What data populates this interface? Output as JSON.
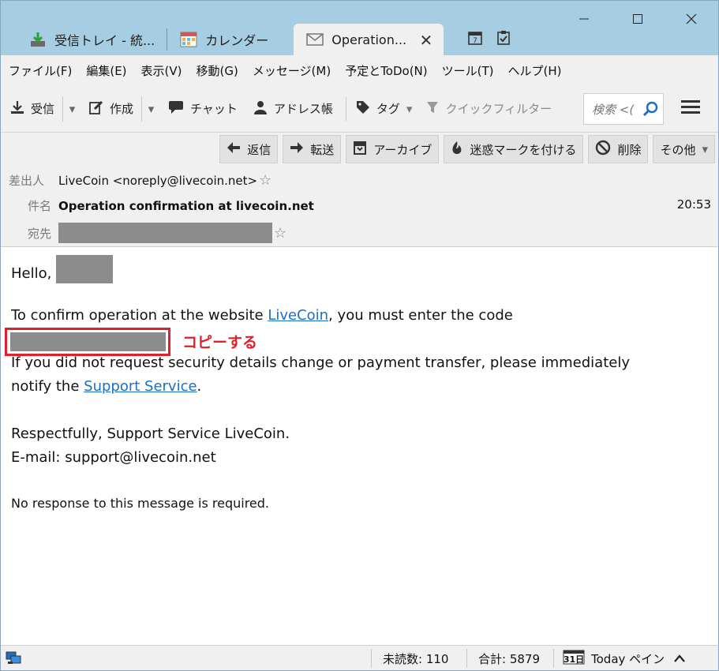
{
  "window": {
    "tabs": [
      {
        "label": "受信トレイ - 統..."
      },
      {
        "label": "カレンダー"
      },
      {
        "label": "Operation..."
      }
    ]
  },
  "menubar": {
    "items": [
      "ファイル(F)",
      "編集(E)",
      "表示(V)",
      "移動(G)",
      "メッセージ(M)",
      "予定とToDo(N)",
      "ツール(T)",
      "ヘルプ(H)"
    ]
  },
  "toolbar": {
    "receive": "受信",
    "compose": "作成",
    "chat": "チャット",
    "address_book": "アドレス帳",
    "tag": "タグ",
    "quick_filter": "クイックフィルター",
    "search_placeholder": "検索 <("
  },
  "message": {
    "actions": {
      "reply": "返信",
      "forward": "転送",
      "archive": "アーカイブ",
      "junk": "迷惑マークを付ける",
      "delete": "削除",
      "more": "その他"
    },
    "labels": {
      "from": "差出人",
      "subject": "件名",
      "to": "宛先"
    },
    "from": "LiveCoin <noreply@livecoin.net>",
    "subject": "Operation confirmation at livecoin.net",
    "time": "20:53",
    "body": {
      "greeting": "Hello,",
      "confirm_before": "To confirm operation at the website ",
      "confirm_link": "LiveCoin",
      "confirm_after": ", you must enter the code",
      "annotation": "コピーする",
      "warning_line1": "If you did not request security details change or payment transfer, please immediately",
      "warning_line2_before": "notify the ",
      "warning_link": "Support Service",
      "warning_line2_after": ".",
      "sign_line1": "Respectfully, Support Service LiveCoin.",
      "sign_line2": "E-mail: support@livecoin.net",
      "footer": "No response to this message is required."
    }
  },
  "statusbar": {
    "unread": "未読数: 110",
    "total": "合計: 5879",
    "today_pane": "Today ペイン"
  },
  "colors": {
    "titlebar": "#a7cde3",
    "link": "#1a6fc4",
    "annotation": "#e0202a",
    "redaction": "#8c8c8c"
  }
}
